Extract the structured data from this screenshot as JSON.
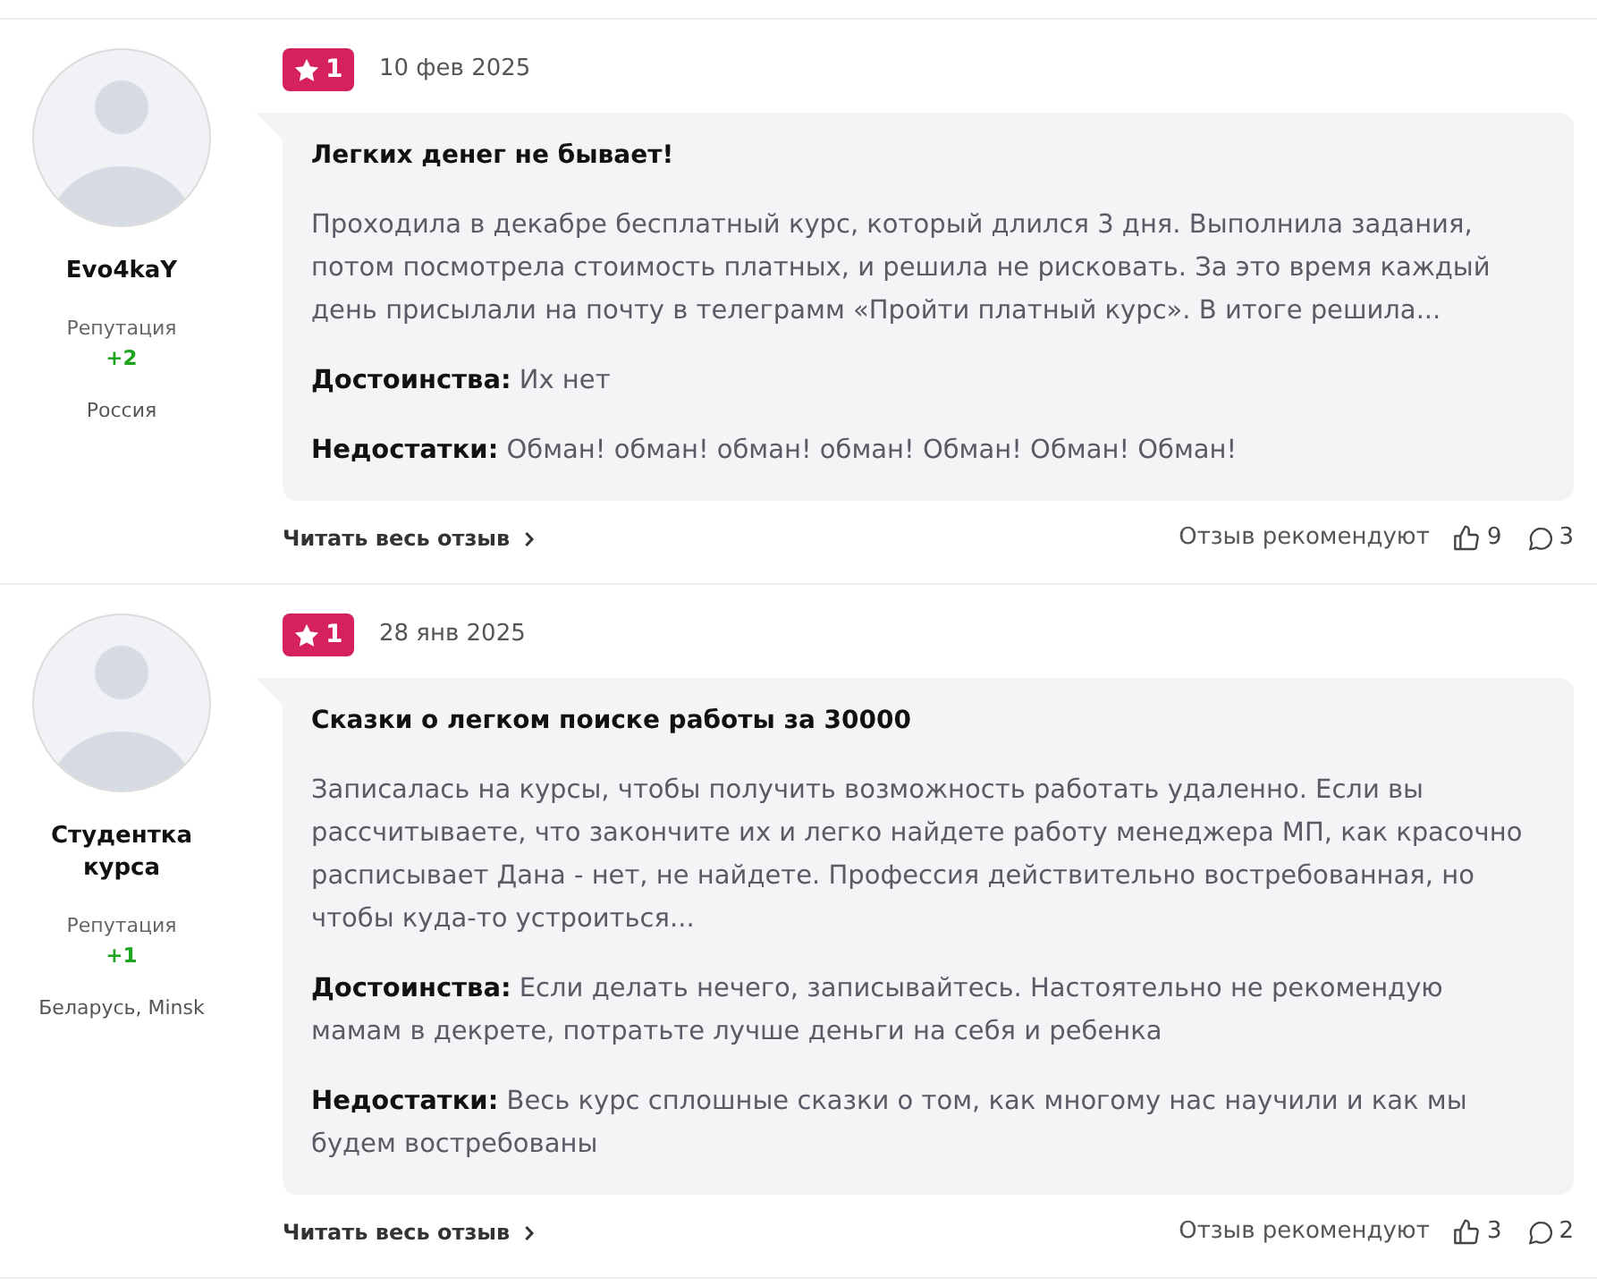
{
  "reviews": [
    {
      "author": {
        "name": "Evo4kaY",
        "reputation_label": "Репутация",
        "reputation": "+2",
        "location": "Россия"
      },
      "rating": "1",
      "date": "10 фев 2025",
      "title": "Легких денег не бывает!",
      "text": "Проходила в декабре бесплатный курс, который длился 3 дня. Выполнила задания, потом посмотрела стоимость платных, и решила не рисковать. За это время каждый день присылали на почту в телеграмм «Пройти платный курс». В итоге решила...",
      "pros": "**Достоинства:** Их нет",
      "cons": "**Недостатки:** Обман! обман! обман! обман! Обман! Обман! Обман!",
      "read_more": "Читать весь отзыв",
      "recommend_label": "Отзыв рекомендуют",
      "likes": "9",
      "comments": "3"
    },
    {
      "author": {
        "name": "Студентка курса",
        "reputation_label": "Репутация",
        "reputation": "+1",
        "location": "Беларусь, Minsk"
      },
      "rating": "1",
      "date": "28 янв 2025",
      "title": "Сказки о легком поиске работы за 30000",
      "text": "Записалась на курсы, чтобы получить возможность работать удаленно. Если вы рассчитываете, что закончите их и легко найдете работу менеджера МП, как красочно расписывает Дана - нет, не найдете. Профессия действительно востребованная, но чтобы куда-то устроиться...",
      "pros": "**Достоинства:** Если делать нечего, записывайтесь. Настоятельно не рекомендую мамам в декрете, потратьте лучше деньги на себя и ребенка",
      "cons": "**Недостатки:** Весь курс сплошные сказки о том, как многому нас научили и как мы будем востребованы",
      "read_more": "Читать весь отзыв",
      "recommend_label": "Отзыв рекомендуют",
      "likes": "3",
      "comments": "2"
    }
  ]
}
